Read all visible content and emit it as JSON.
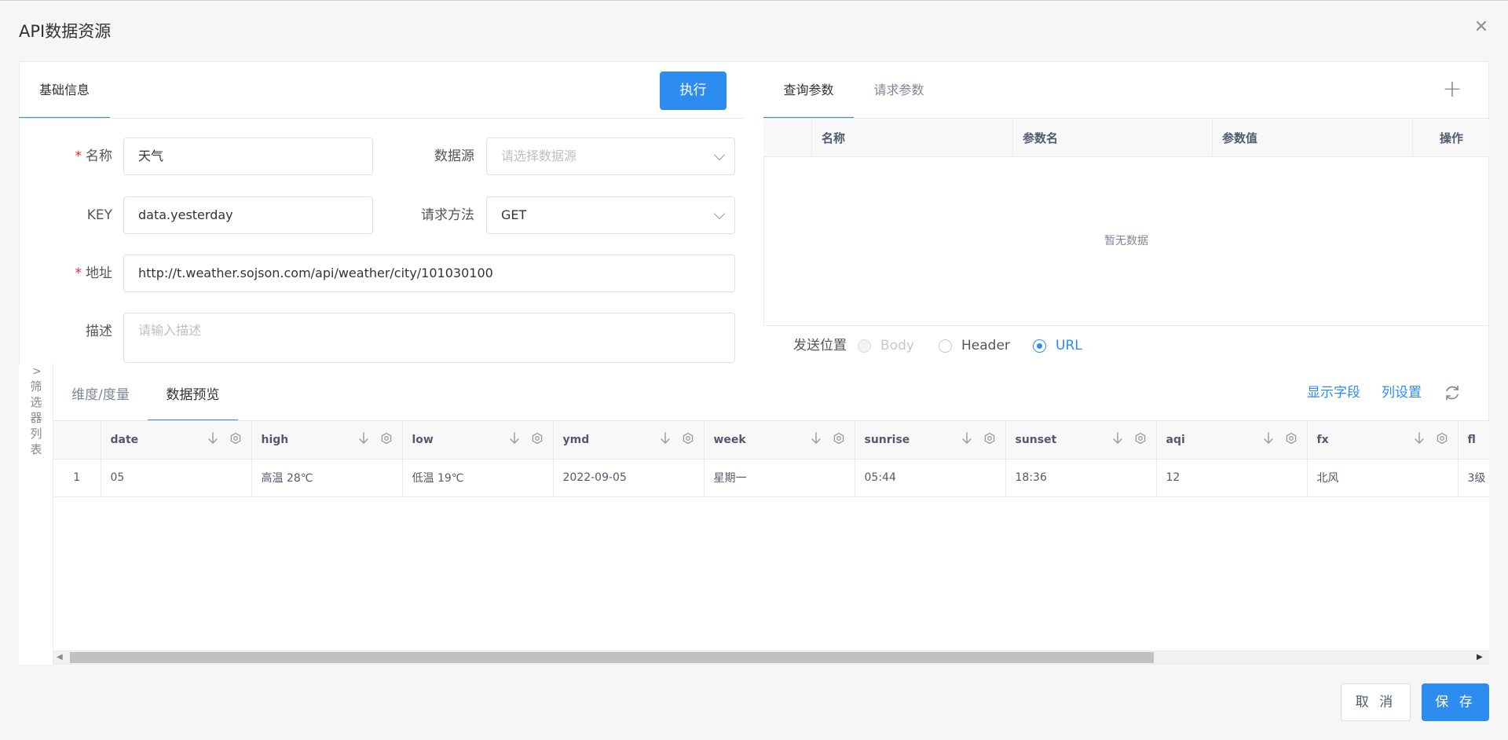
{
  "dialog": {
    "title": "API数据资源"
  },
  "form": {
    "tab_label": "基础信息",
    "execute_label": "执行",
    "name": {
      "label": "名称",
      "value": "天气"
    },
    "datasource": {
      "label": "数据源",
      "placeholder": "请选择数据源"
    },
    "key": {
      "label": "KEY",
      "value": "data.yesterday"
    },
    "method": {
      "label": "请求方法",
      "value": "GET"
    },
    "address": {
      "label": "地址",
      "value": "http://t.weather.sojson.com/api/weather/city/101030100"
    },
    "description": {
      "label": "描述",
      "placeholder": "请输入描述"
    },
    "required_mark": "*"
  },
  "params": {
    "tabs": [
      "查询参数",
      "请求参数"
    ],
    "add_icon": "plus-icon",
    "columns": [
      "名称",
      "参数名",
      "参数值",
      "操作"
    ],
    "empty_text": "暂无数据",
    "send_position": {
      "label": "发送位置",
      "options": [
        "Body",
        "Header",
        "URL"
      ],
      "selected": "URL",
      "disabled": "Body"
    }
  },
  "filter_panel": {
    "label": "筛选器列表",
    "chars": [
      "筛",
      "选",
      "器",
      "列",
      "表"
    ]
  },
  "preview": {
    "tabs": [
      "维度/度量",
      "数据预览"
    ],
    "active_tab": "数据预览",
    "show_fields_label": "显示字段",
    "column_settings_label": "列设置",
    "refresh_icon": "refresh-icon",
    "columns": [
      "date",
      "high",
      "low",
      "ymd",
      "week",
      "sunrise",
      "sunset",
      "aqi",
      "fx",
      "fl"
    ],
    "rows": [
      [
        "1",
        "05",
        "高温 28℃",
        "低温 19℃",
        "2022-09-05",
        "星期一",
        "05:44",
        "18:36",
        "12",
        "北风",
        "3级"
      ]
    ]
  },
  "footer": {
    "cancel_label": "取 消",
    "save_label": "保 存"
  },
  "colors": {
    "primary": "#2d8cf0",
    "required": "#f5222d"
  }
}
